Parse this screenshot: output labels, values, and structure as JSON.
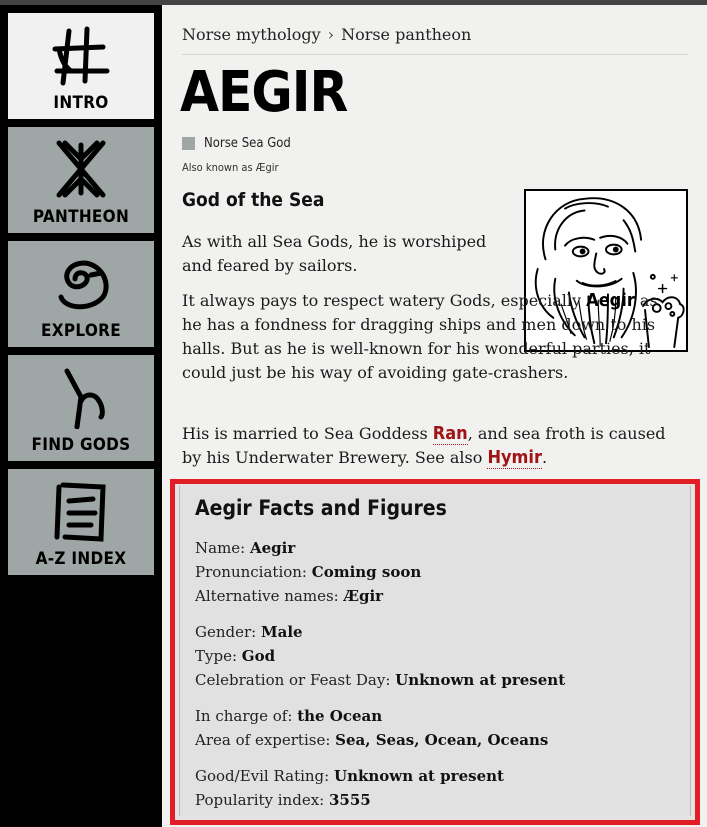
{
  "sidebar": {
    "items": [
      {
        "label": "INTRO",
        "icon": "intro-rune-icon",
        "active": true
      },
      {
        "label": "PANTHEON",
        "icon": "pantheon-rune-icon",
        "active": false
      },
      {
        "label": "EXPLORE",
        "icon": "explore-rune-icon",
        "active": false
      },
      {
        "label": "FIND GODS",
        "icon": "find-gods-rune-icon",
        "active": false
      },
      {
        "label": "A-Z INDEX",
        "icon": "az-index-rune-icon",
        "active": false
      }
    ]
  },
  "breadcrumb": [
    "Norse mythology",
    "Norse pantheon"
  ],
  "page": {
    "title": "AEGIR",
    "subtitle": "Norse Sea God",
    "aka": "Also known as Ægir",
    "section_heading": "God of the Sea",
    "p1": "As with all Sea Gods, he is worshiped and feared by sailors.",
    "p2_a": "It always pays to respect watery Gods, especially ",
    "p2_name": "Aegir",
    "p2_b": " as he has a fondness for dragging ships and men down to his halls. But as he is well-known for his wonderful parties, it could just be his way of avoiding gate-crashers.",
    "p3_a": "His is married to Sea Goddess ",
    "p3_link1": "Ran",
    "p3_b": ", and sea froth is caused by his Underwater Brewery. See also ",
    "p3_link2": "Hymir",
    "p3_c": "."
  },
  "facts": {
    "heading": "Aegir Facts and Figures",
    "rows": [
      {
        "label": "Name: ",
        "value": "Aegir"
      },
      {
        "label": "Pronunciation: ",
        "value": "Coming soon"
      },
      {
        "label": "Alternative names: ",
        "value": "Ægir"
      },
      {
        "label": "Gender: ",
        "value": "Male"
      },
      {
        "label": "Type: ",
        "value": "God"
      },
      {
        "label": "Celebration or Feast Day: ",
        "value": "Unknown at present"
      },
      {
        "label": "In charge of: ",
        "value": "the Ocean"
      },
      {
        "label": "Area of expertise: ",
        "value": "Sea, Seas, Ocean, Oceans"
      },
      {
        "label": "Good/Evil Rating: ",
        "value": "Unknown at present"
      },
      {
        "label": "Popularity index: ",
        "value": "3555"
      }
    ]
  },
  "colors": {
    "sidebar_inactive": "#9ea6a6",
    "sidebar_active": "#f1f1f1",
    "facts_border": "#e11e25",
    "link_red": "#a01416"
  }
}
